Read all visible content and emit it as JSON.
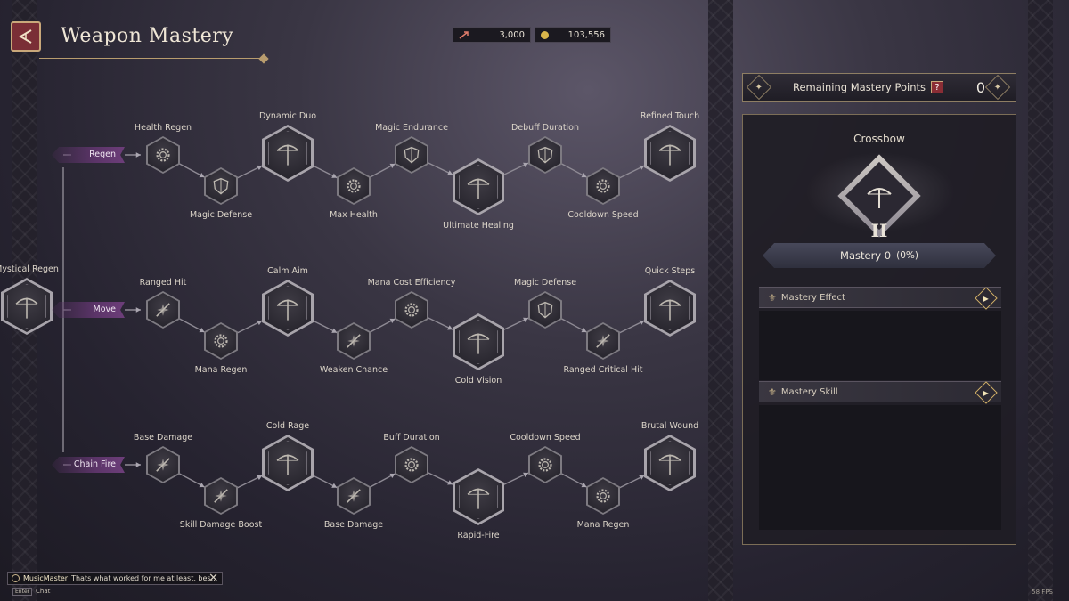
{
  "header": {
    "title": "Weapon Mastery",
    "currency": [
      {
        "icon": "arrow-token-icon",
        "value": "3,000"
      },
      {
        "icon": "gold-coin-icon",
        "value": "103,556"
      }
    ]
  },
  "tree": {
    "root": {
      "label": "Mystical Regen"
    },
    "categories": [
      {
        "name": "Regen",
        "nodes": [
          {
            "label": "Health Regen",
            "type": "gear-icon",
            "big": false
          },
          {
            "label": "Magic Defense",
            "type": "shield-icon",
            "big": false
          },
          {
            "label": "Dynamic Duo",
            "type": "crossbow-icon",
            "big": true
          },
          {
            "label": "Max Health",
            "type": "gear-icon",
            "big": false
          },
          {
            "label": "Magic Endurance",
            "type": "shield-icon",
            "big": false
          },
          {
            "label": "Ultimate Healing",
            "type": "crossbow-icon",
            "big": true
          },
          {
            "label": "Debuff Duration",
            "type": "shield-icon",
            "big": false
          },
          {
            "label": "Cooldown Speed",
            "type": "gear-icon",
            "big": false
          },
          {
            "label": "Refined Touch",
            "type": "crossbow-icon",
            "big": true
          }
        ]
      },
      {
        "name": "Move",
        "nodes": [
          {
            "label": "Ranged Hit",
            "type": "burst-icon",
            "big": false
          },
          {
            "label": "Mana Regen",
            "type": "gear-icon",
            "big": false
          },
          {
            "label": "Calm Aim",
            "type": "crossbow-icon",
            "big": true
          },
          {
            "label": "Weaken Chance",
            "type": "burst-icon",
            "big": false
          },
          {
            "label": "Mana Cost Efficiency",
            "type": "gear-icon",
            "big": false
          },
          {
            "label": "Cold Vision",
            "type": "crossbow-icon",
            "big": true
          },
          {
            "label": "Magic Defense",
            "type": "shield-icon",
            "big": false
          },
          {
            "label": "Ranged Critical Hit",
            "type": "burst-icon",
            "big": false
          },
          {
            "label": "Quick Steps",
            "type": "crossbow-icon",
            "big": true
          }
        ]
      },
      {
        "name": "Chain Fire",
        "nodes": [
          {
            "label": "Base Damage",
            "type": "burst-icon",
            "big": false
          },
          {
            "label": "Skill Damage Boost",
            "type": "burst-icon",
            "big": false
          },
          {
            "label": "Cold Rage",
            "type": "crossbow-icon",
            "big": true
          },
          {
            "label": "Base Damage",
            "type": "burst-icon",
            "big": false
          },
          {
            "label": "Buff Duration",
            "type": "gear-icon",
            "big": false
          },
          {
            "label": "Rapid-Fire",
            "type": "crossbow-icon",
            "big": true
          },
          {
            "label": "Cooldown Speed",
            "type": "gear-icon",
            "big": false
          },
          {
            "label": "Mana Regen",
            "type": "gear-icon",
            "big": false
          },
          {
            "label": "Brutal Wound",
            "type": "crossbow-icon",
            "big": true
          }
        ]
      }
    ]
  },
  "panel": {
    "points_label": "Remaining Mastery Points",
    "points_value": "0",
    "help": "?",
    "weapon": "Crossbow",
    "rank": "II",
    "mastery_label": "Mastery 0",
    "mastery_percent": "(0%)",
    "mastery_fraction": 0,
    "effect_header": "Mastery Effect",
    "skill_header": "Mastery Skill"
  },
  "chat": {
    "user": "MusicMaster",
    "message": "Thats what worked for me at least, bes...",
    "key": "Enter",
    "label": "Chat"
  },
  "fps": "58 FPS",
  "colors": {
    "accent_gold": "#c9a87a",
    "category_purple": "#6d3e7a",
    "back_red": "#7a2e36"
  }
}
